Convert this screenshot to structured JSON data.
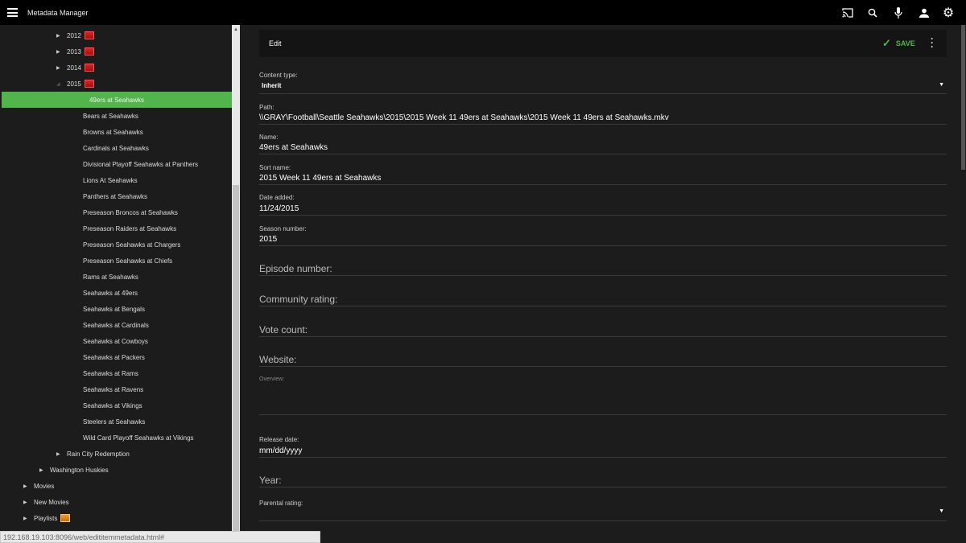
{
  "header": {
    "title": "Metadata Manager"
  },
  "sidebar": {
    "years": [
      "2012",
      "2013",
      "2014",
      "2015"
    ],
    "selected": "49ers at Seahawks",
    "episodes": [
      "Bears at Seahawks",
      "Browns at Seahawks",
      "Cardinals at Seahawks",
      "Divisional Playoff Seahawks at Panthers",
      "Lions At Seahawks",
      "Panthers at Seahawks",
      "Preseason Broncos at Seahawks",
      "Preseason Raiders at Seahawks",
      "Preseason Seahawks at Chargers",
      "Preseason Seahawks at Chiefs",
      "Rams at Seahawks",
      "Seahawks at 49ers",
      "Seahawks at Bengals",
      "Seahawks at Cardinals",
      "Seahawks at Cowboys",
      "Seahawks at Packers",
      "Seahawks at Rams",
      "Seahawks at Ravens",
      "Seahawks at Vikings",
      "Steelers at Seahawks",
      "Wild Card Playoff Seahawks at Vikings"
    ],
    "rain_city": "Rain City Redemption",
    "huskies": "Washington Huskies",
    "movies": "Movies",
    "new_movies": "New Movies",
    "playlists": "Playlists"
  },
  "editbar": {
    "title": "Edit",
    "save": "SAVE"
  },
  "form": {
    "content_type_label": "Content type:",
    "content_type_value": "Inherit",
    "path_label": "Path:",
    "path_value": "\\\\GRAY\\Football\\Seattle Seahawks\\2015\\2015 Week 11 49ers at Seahawks\\2015 Week 11 49ers at Seahawks.mkv",
    "name_label": "Name:",
    "name_value": "49ers at Seahawks",
    "sort_label": "Sort name:",
    "sort_value": "2015 Week 11 49ers at Seahawks",
    "date_label": "Date added:",
    "date_value": "11/24/2015",
    "season_label": "Season number:",
    "season_value": "2015",
    "episode_label": "Episode number:",
    "community_label": "Community rating:",
    "vote_label": "Vote count:",
    "website_label": "Website:",
    "overview_label": "Overview:",
    "release_label": "Release date:",
    "release_value": "mm/dd/yyyy",
    "year_label": "Year:",
    "parental_label": "Parental rating:"
  },
  "status_url": "192.168.19.103:8096/web/edititemmetadata.html#",
  "colors": {
    "accent": "#52b54b",
    "header": "#000000",
    "background": "#1c1c1c"
  }
}
